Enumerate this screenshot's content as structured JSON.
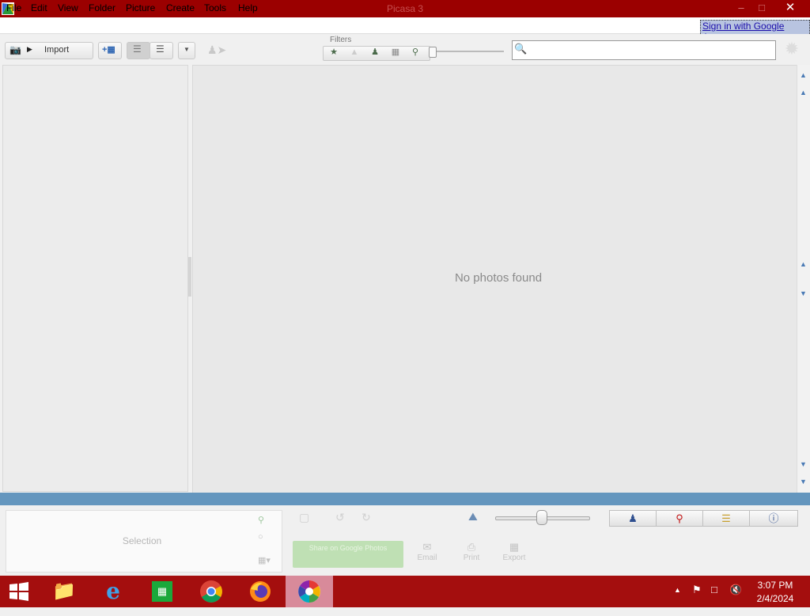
{
  "window": {
    "title": "Picasa 3"
  },
  "menu": [
    "File",
    "Edit",
    "View",
    "Folder",
    "Picture",
    "Create",
    "Tools",
    "Help"
  ],
  "signin": "Sign in with Google Account",
  "toolbar": {
    "import_label": "Import",
    "filters_label": "Filters",
    "search": {
      "value": "",
      "placeholder": ""
    }
  },
  "library": {
    "empty_message": "No photos found"
  },
  "tray": {
    "selection_label": "Selection"
  },
  "share": {
    "label": "Share on Google Photos"
  },
  "actions": {
    "email": "Email",
    "print": "Print",
    "export": "Export"
  },
  "taskbar": {
    "time": "3:07 PM",
    "date": "2/4/2024"
  },
  "colors": {
    "titlebar": "#9b0000",
    "taskbar": "#a40e0e",
    "divider": "#6496be"
  }
}
